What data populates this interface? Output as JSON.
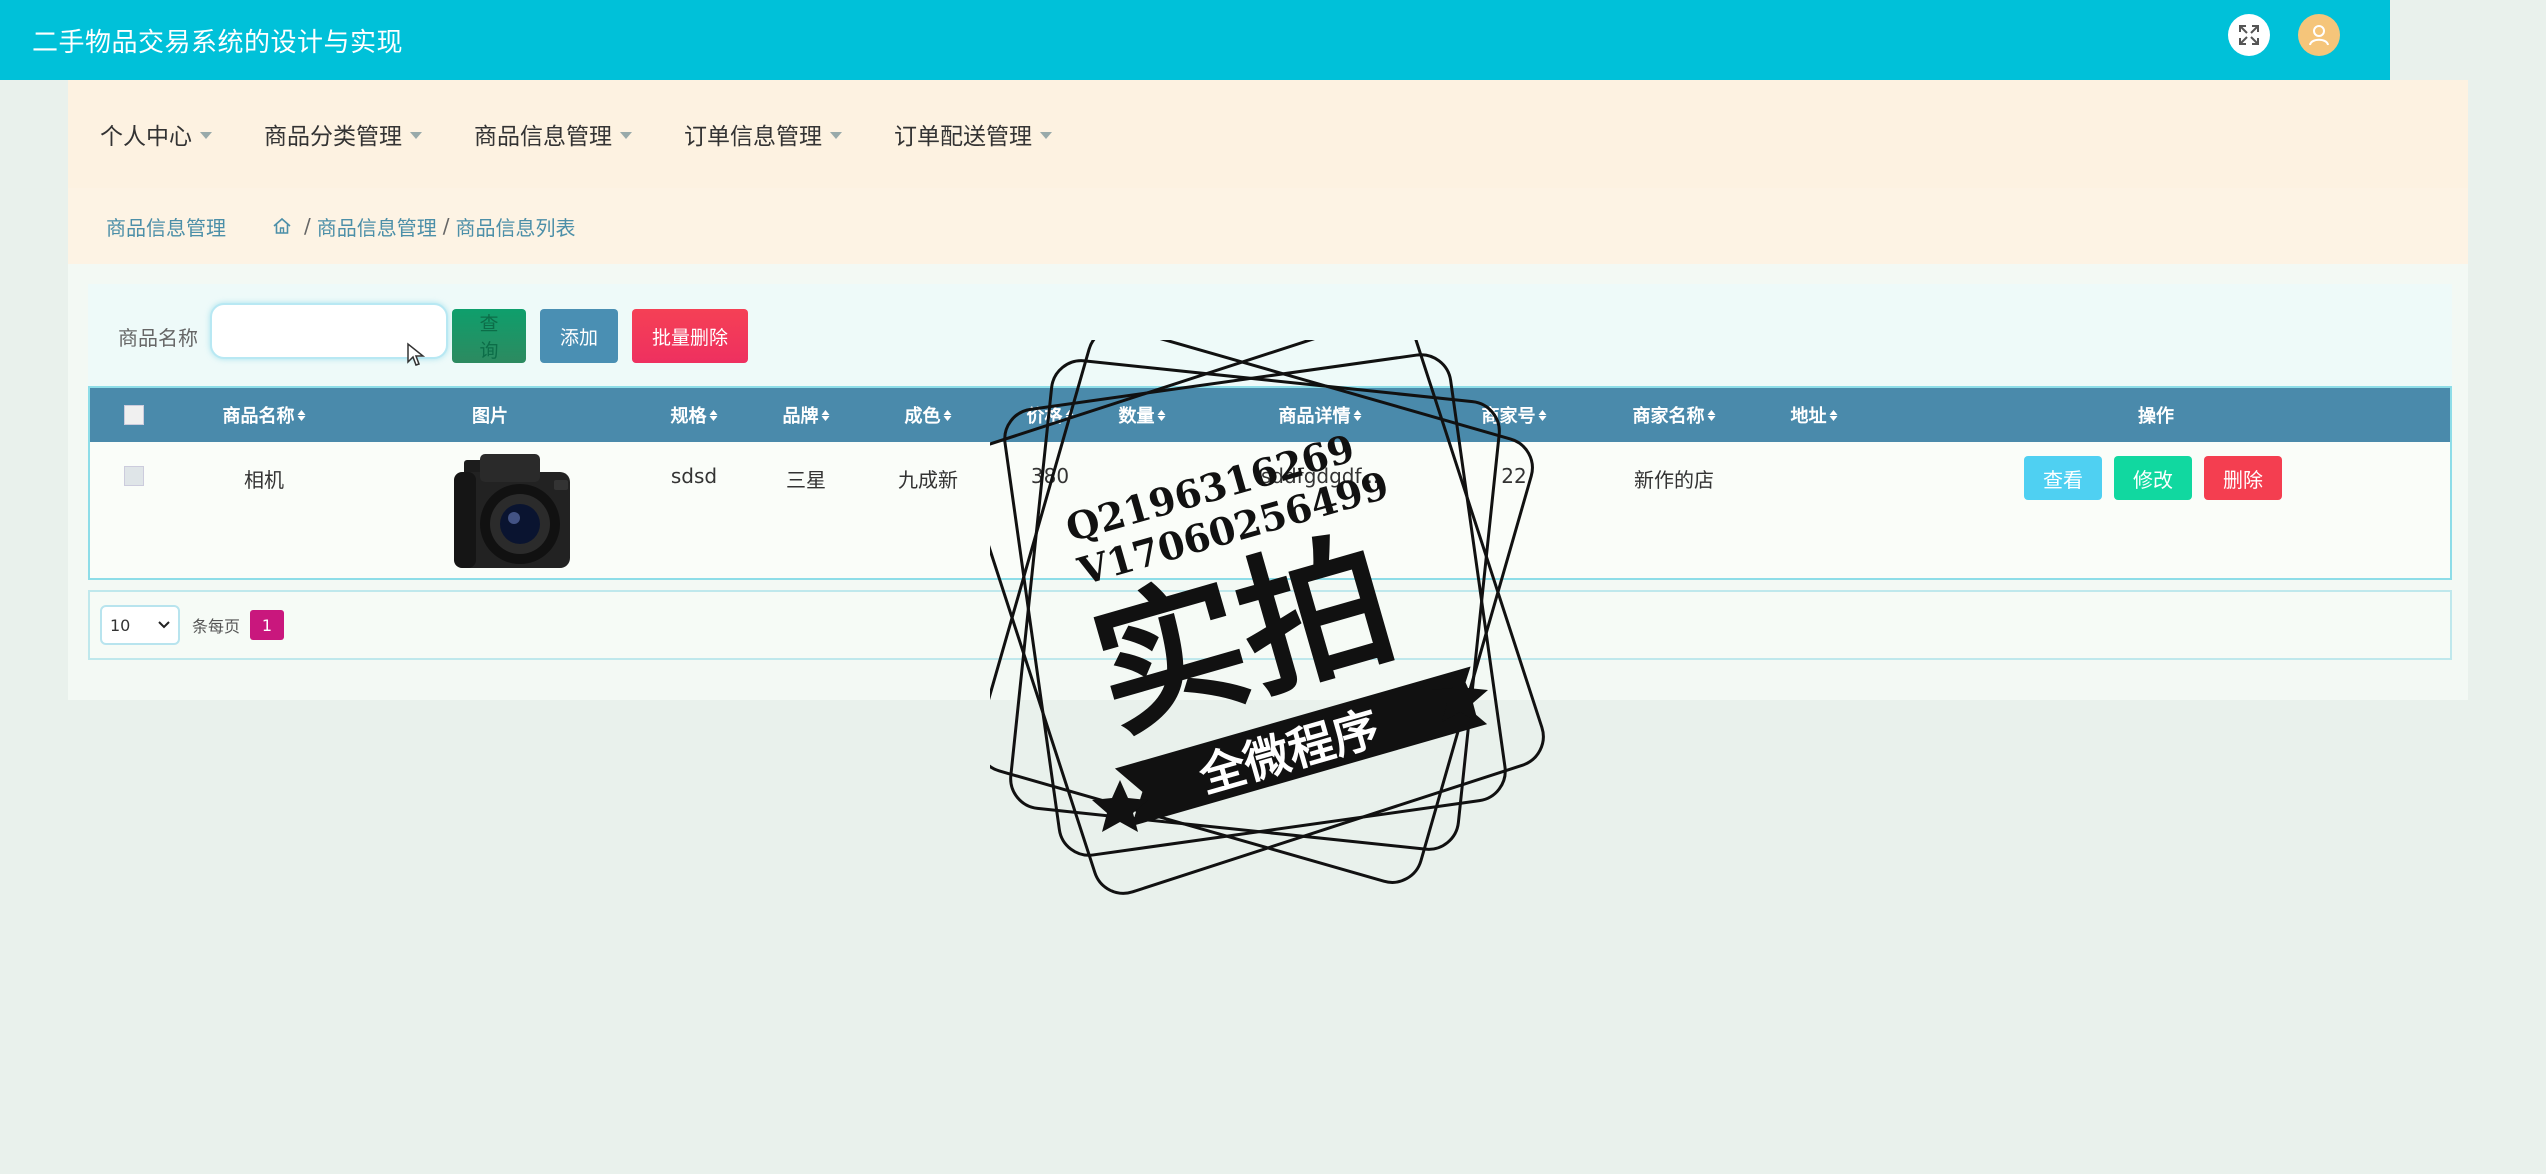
{
  "app": {
    "title": "二手物品交易系统的设计与实现"
  },
  "nav": {
    "items": [
      {
        "label": "个人中心"
      },
      {
        "label": "商品分类管理"
      },
      {
        "label": "商品信息管理"
      },
      {
        "label": "订单信息管理"
      },
      {
        "label": "订单配送管理"
      }
    ]
  },
  "breadcrumb": {
    "title": "商品信息管理",
    "sep": "/",
    "level1": "商品信息管理",
    "level2": "商品信息列表"
  },
  "search": {
    "label": "商品名称",
    "value": "",
    "search_btn": "查询",
    "add_btn": "添加",
    "batch_delete_btn": "批量删除"
  },
  "table": {
    "headers": {
      "name": "商品名称",
      "image": "图片",
      "spec": "规格",
      "brand": "品牌",
      "condition": "成色",
      "price": "价格",
      "quantity": "数量",
      "detail": "商品详情",
      "merchant_no": "商家号",
      "merchant_name": "商家名称",
      "address": "地址",
      "actions": "操作"
    },
    "rows": [
      {
        "name": "相机",
        "spec": "sdsd",
        "brand": "三星",
        "condition": "九成新",
        "price": "380",
        "detail": "sddfgdgdf...",
        "merchant_no": "22",
        "merchant_name": "新作的店",
        "view": "查看",
        "edit": "修改",
        "delete": "删除"
      }
    ]
  },
  "pagination": {
    "page_size": "10",
    "per_page_label": "条每页",
    "current_page": "1"
  },
  "watermark": {
    "line1": "Q2196316269",
    "line2": "V17060256499",
    "main": "实拍",
    "ribbon": "全微程序"
  }
}
